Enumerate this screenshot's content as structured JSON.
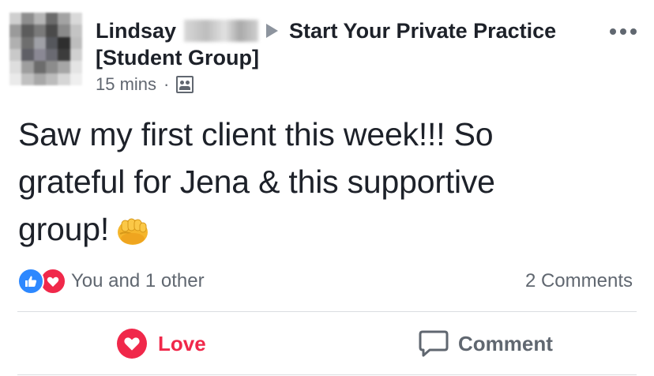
{
  "post": {
    "author_first_name": "Lindsay",
    "group_name_line1": "Start Your Private Practice",
    "group_name_line2": "[Student Group]",
    "timestamp": "15 mins",
    "separator": "·",
    "audience_icon": "group-icon",
    "text_line1": "Saw my first client this week!!! So",
    "text_line2": "grateful for Jena & this supportive",
    "text_line3": "group!",
    "emoji": "fist-bump-emoji"
  },
  "reactions": {
    "icons": [
      "like-reaction-icon",
      "love-reaction-icon"
    ],
    "summary": "You and 1 other",
    "comments_count": "2 Comments"
  },
  "actions": {
    "love_label": "Love",
    "comment_label": "Comment"
  },
  "colors": {
    "text": "#1d2129",
    "muted": "#606770",
    "like_blue": "#2d88ff",
    "love_red": "#f0284a",
    "divider": "#dadde1"
  }
}
